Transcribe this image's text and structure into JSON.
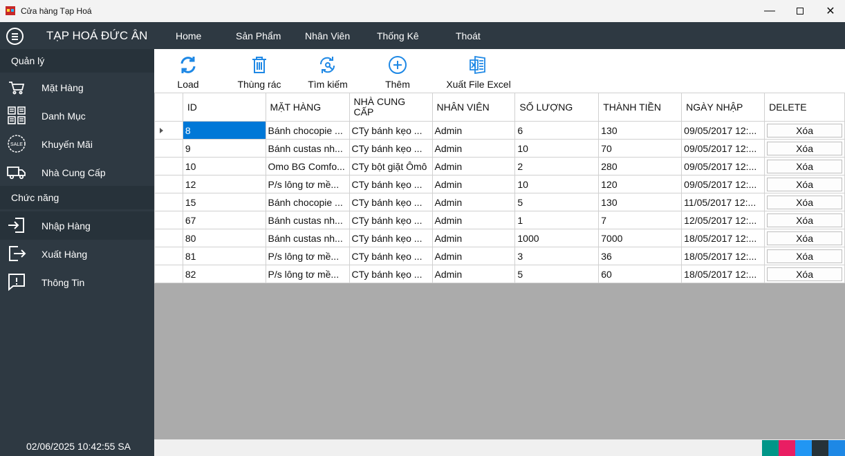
{
  "window": {
    "title": "Cửa hàng Tạp Hoá"
  },
  "menubar": {
    "brand": "TẠP HOÁ ĐỨC ÂN",
    "items": [
      "Home",
      "Sản Phẩm",
      "Nhân Viên",
      "Thống Kê",
      "Thoát"
    ]
  },
  "sidebar": {
    "sections": [
      {
        "header": "Quản lý",
        "items": [
          {
            "label": "Mặt Hàng",
            "icon": "cart-icon"
          },
          {
            "label": "Danh Mục",
            "icon": "grid-icon"
          },
          {
            "label": "Khuyến Mãi",
            "icon": "sale-icon"
          },
          {
            "label": "Nhà Cung Cấp",
            "icon": "truck-icon"
          }
        ]
      },
      {
        "header": "Chức năng",
        "items": [
          {
            "label": "Nhập Hàng",
            "icon": "import-icon"
          },
          {
            "label": "Xuất Hàng",
            "icon": "export-icon"
          },
          {
            "label": "Thông Tin",
            "icon": "info-icon"
          }
        ]
      }
    ],
    "clock": "02/06/2025 10:42:55 SA"
  },
  "toolbar": {
    "items": [
      {
        "label": "Load",
        "icon": "refresh-icon"
      },
      {
        "label": "Thùng rác",
        "icon": "trash-icon"
      },
      {
        "label": "Tìm kiếm",
        "icon": "search-refresh-icon"
      },
      {
        "label": "Thêm",
        "icon": "add-icon"
      },
      {
        "label": "Xuất File Excel",
        "icon": "excel-icon"
      }
    ]
  },
  "grid": {
    "columns": [
      "ID",
      "MẶT HÀNG",
      "NHÀ CUNG CẤP",
      "NHÂN VIÊN",
      "SỐ LƯỢNG",
      "THÀNH TIỀN",
      "NGÀY NHẬP",
      "DELETE"
    ],
    "delete_label": "Xóa",
    "rows": [
      [
        "8",
        "Bánh chocopie ...",
        "CTy bánh kẹo ...",
        "Admin",
        "6",
        "130",
        "09/05/2017 12:..."
      ],
      [
        "9",
        "Bánh custas nh...",
        "CTy bánh kẹo ...",
        "Admin",
        "10",
        "70",
        "09/05/2017 12:..."
      ],
      [
        "10",
        "Omo BG Comfo...",
        "CTy bột giặt Ômô",
        "Admin",
        "2",
        "280",
        "09/05/2017 12:..."
      ],
      [
        "12",
        "P/s lông tơ mề...",
        "CTy bánh kẹo ...",
        "Admin",
        "10",
        "120",
        "09/05/2017 12:..."
      ],
      [
        "15",
        "Bánh chocopie ...",
        "CTy bánh kẹo ...",
        "Admin",
        "5",
        "130",
        "11/05/2017 12:..."
      ],
      [
        "67",
        "Bánh custas nh...",
        "CTy bánh kẹo ...",
        "Admin",
        "1",
        "7",
        "12/05/2017 12:..."
      ],
      [
        "80",
        "Bánh custas nh...",
        "CTy bánh kẹo ...",
        "Admin",
        "1000",
        "7000",
        "18/05/2017 12:..."
      ],
      [
        "81",
        "P/s lông tơ mề...",
        "CTy bánh kẹo ...",
        "Admin",
        "3",
        "36",
        "18/05/2017 12:..."
      ],
      [
        "82",
        "P/s lông tơ mề...",
        "CTy bánh kẹo ...",
        "Admin",
        "5",
        "60",
        "18/05/2017 12:..."
      ]
    ],
    "selected_row": 0
  },
  "theme_swatches": [
    "#009688",
    "#e91e63",
    "#2196f3",
    "#263238",
    "#1e88e5"
  ],
  "colors": {
    "accent": "#1e88e5",
    "sidebar": "#2e3942",
    "selection": "#0078d7"
  }
}
